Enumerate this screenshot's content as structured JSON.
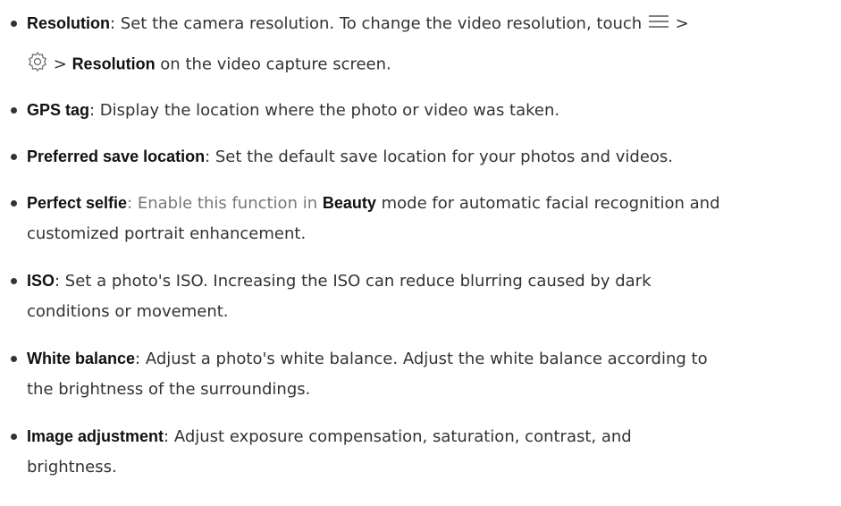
{
  "items": [
    {
      "term": "Resolution",
      "desc_a": ": Set the camera resolution. To change the video resolution, touch",
      "gt1": ">",
      "gt2": ">",
      "term2": "Resolution",
      "desc_b": "on the video capture screen."
    },
    {
      "term": "GPS tag",
      "desc": ": Display the location where the photo or video was taken."
    },
    {
      "term": "Preferred save location",
      "desc": ": Set the default save location for your photos and videos."
    },
    {
      "term": "Perfect selfie",
      "desc_a": ": Enable this function in",
      "term2": "Beauty",
      "desc_b": "mode for automatic facial recognition and",
      "desc_c": "customized portrait enhancement."
    },
    {
      "term": "ISO",
      "desc_a": ": Set a photo's ISO. Increasing the ISO can reduce blurring caused by dark",
      "desc_b": "conditions or movement."
    },
    {
      "term": "White balance",
      "desc_a": ": Adjust a photo's white balance. Adjust the white balance according to",
      "desc_b": "the brightness of the surroundings."
    },
    {
      "term": "Image adjustment",
      "desc_a": ": Adjust exposure compensation, saturation, contrast, and",
      "desc_b": "brightness."
    }
  ],
  "icons": {
    "menu": "menu-icon",
    "settings": "settings-gear-icon"
  }
}
